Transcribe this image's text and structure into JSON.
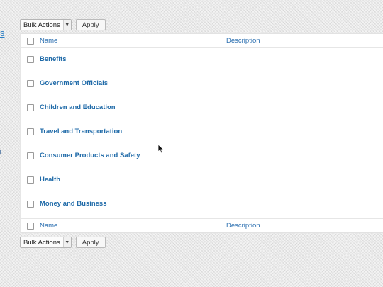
{
  "left_edge": {
    "link_fragment": "s"
  },
  "bulk_actions": {
    "top": {
      "select_value": "Bulk Actions",
      "apply_label": "Apply"
    },
    "bottom": {
      "select_value": "Bulk Actions",
      "apply_label": "Apply"
    }
  },
  "table": {
    "header": {
      "name": "Name",
      "description": "Description"
    },
    "footer": {
      "name": "Name",
      "description": "Description"
    },
    "rows": [
      {
        "name": "Benefits"
      },
      {
        "name": "Government Officials"
      },
      {
        "name": "Children and Education"
      },
      {
        "name": "Travel and Transportation"
      },
      {
        "name": "Consumer Products and Safety"
      },
      {
        "name": "Health"
      },
      {
        "name": "Money and Business"
      }
    ]
  },
  "colors": {
    "link": "#1f6aa8",
    "header_link": "#2b6fb0",
    "table_bg": "#ffffff"
  },
  "icons": {
    "dropdown": "chevron-down-icon",
    "cursor": "mouse-pointer-icon"
  }
}
